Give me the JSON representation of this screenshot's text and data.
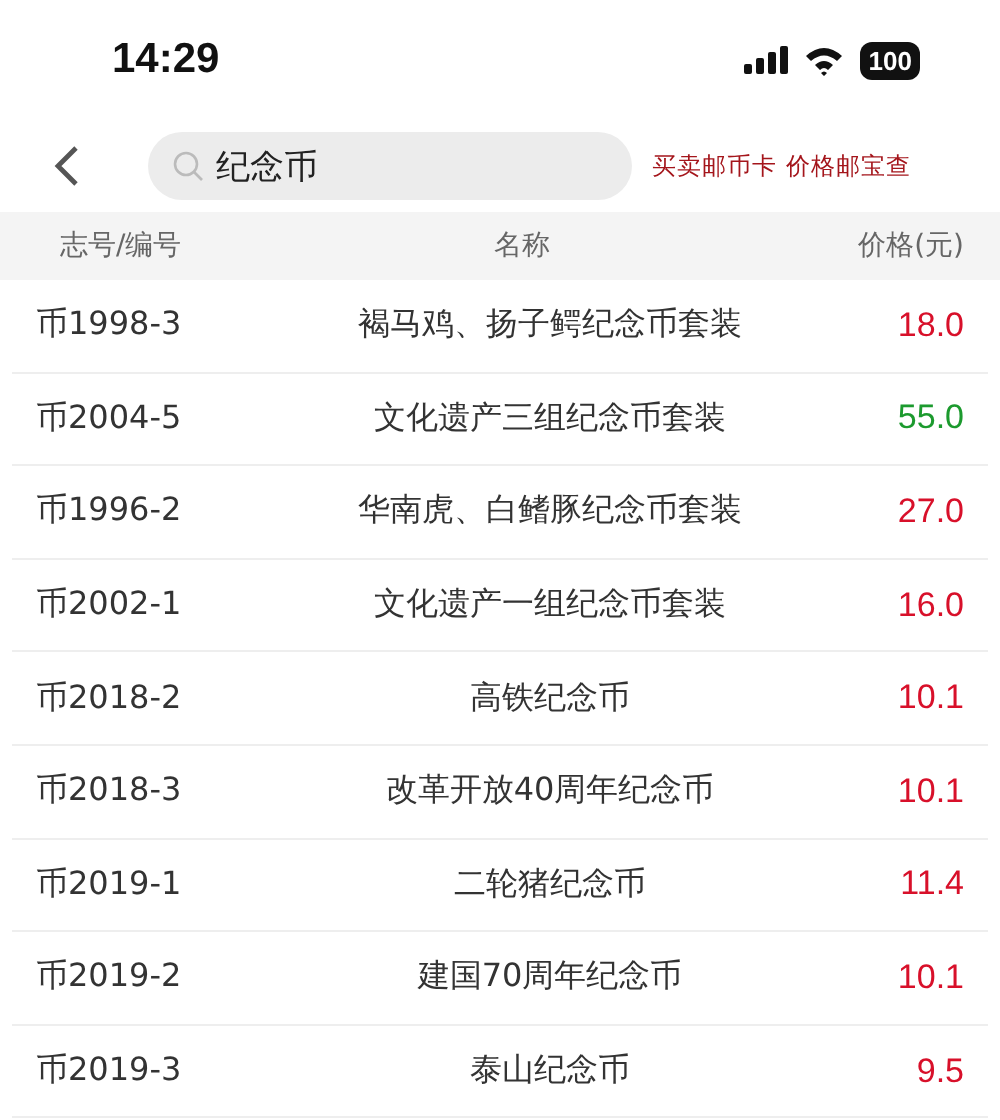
{
  "status_bar": {
    "time": "14:29",
    "battery": "100"
  },
  "search": {
    "value": "纪念币"
  },
  "slogan": "买卖邮币卡 价格邮宝查",
  "columns": [
    "志号/编号",
    "名称",
    "价格(元)"
  ],
  "rows": [
    {
      "code": "币1998-3",
      "name": "褐马鸡、扬子鳄纪念币套装",
      "price": "18.0",
      "color": "#d8102a"
    },
    {
      "code": "币2004-5",
      "name": "文化遗产三组纪念币套装",
      "price": "55.0",
      "color": "#1c9a2e"
    },
    {
      "code": "币1996-2",
      "name": "华南虎、白鳍豚纪念币套装",
      "price": "27.0",
      "color": "#d8102a"
    },
    {
      "code": "币2002-1",
      "name": "文化遗产一组纪念币套装",
      "price": "16.0",
      "color": "#d8102a"
    },
    {
      "code": "币2018-2",
      "name": "高铁纪念币",
      "price": "10.1",
      "color": "#d8102a"
    },
    {
      "code": "币2018-3",
      "name": "改革开放40周年纪念币",
      "price": "10.1",
      "color": "#d8102a"
    },
    {
      "code": "币2019-1",
      "name": "二轮猪纪念币",
      "price": "11.4",
      "color": "#d8102a"
    },
    {
      "code": "币2019-2",
      "name": "建国70周年纪念币",
      "price": "10.1",
      "color": "#d8102a"
    },
    {
      "code": "币2019-3",
      "name": "泰山纪念币",
      "price": "9.5",
      "color": "#d8102a"
    }
  ]
}
